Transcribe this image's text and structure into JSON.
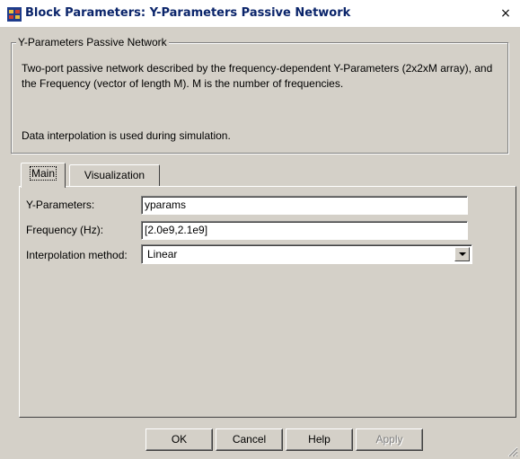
{
  "window": {
    "title": "Block Parameters: Y-Parameters Passive Network",
    "icon": "simulink-block-icon",
    "close_label": "×"
  },
  "description": {
    "group_title": "Y-Parameters Passive Network",
    "text": "Two-port passive network described by the frequency-dependent Y-Parameters (2x2xM array), and the Frequency (vector of length M).  M is the number of frequencies.",
    "note": "Data interpolation is used during simulation."
  },
  "tabs": [
    {
      "label": "Main",
      "active": true
    },
    {
      "label": "Visualization",
      "active": false
    }
  ],
  "fields": {
    "y_parameters": {
      "label": "Y-Parameters:",
      "value": "yparams"
    },
    "frequency": {
      "label": "Frequency (Hz):",
      "value": "[2.0e9,2.1e9]"
    },
    "interpolation": {
      "label": "Interpolation method:",
      "value": "Linear"
    }
  },
  "buttons": {
    "ok": "OK",
    "cancel": "Cancel",
    "help": "Help",
    "apply": "Apply"
  },
  "colors": {
    "dialog_bg": "#d4d0c8",
    "title_text": "#0a246a",
    "disabled_text": "#808080"
  }
}
